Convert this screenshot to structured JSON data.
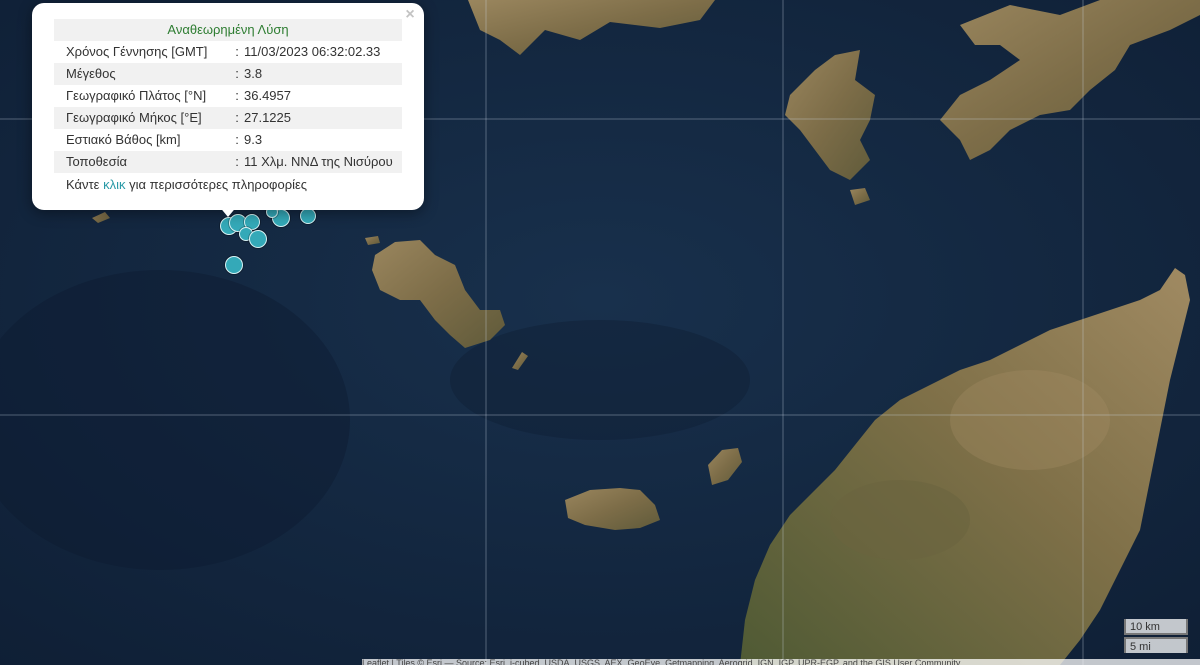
{
  "popup": {
    "title": "Αναθεωρημένη Λύση",
    "close_symbol": "×",
    "rows": [
      {
        "label": "Χρόνος Γέννησης [GMT]",
        "sep": ":",
        "value": "11/03/2023 06:32:02.33"
      },
      {
        "label": "Μέγεθος",
        "sep": ":",
        "value": "3.8"
      },
      {
        "label": "Γεωγραφικό Πλάτος [°N]",
        "sep": ":",
        "value": "36.4957"
      },
      {
        "label": "Γεωγραφικό Μήκος [°E]",
        "sep": ":",
        "value": "27.1225"
      },
      {
        "label": "Εστιακό Βάθος [km]",
        "sep": ":",
        "value": "9.3"
      },
      {
        "label": "Τοποθεσία",
        "sep": ":",
        "value": "11 Χλμ. ΝΝΔ της Νισύρου"
      }
    ],
    "more_prefix": "Κάντε ",
    "more_link": "κλικ",
    "more_suffix": " για περισσότερες πληροφορίες"
  },
  "scale": {
    "km": "10 km",
    "mi": "5 mi"
  },
  "attribution": "Leaflet | Tiles © Esri — Source: Esri, i-cubed, USDA, USGS, AEX, GeoEye, Getmapping, Aerogrid, IGN, IGP, UPR-EGP, and the GIS User Community",
  "colors": {
    "marker": "#34a9b8",
    "sea": "#14263f",
    "land": "#8c7a55",
    "title": "#2e7d32",
    "link": "#2a9aa7"
  }
}
